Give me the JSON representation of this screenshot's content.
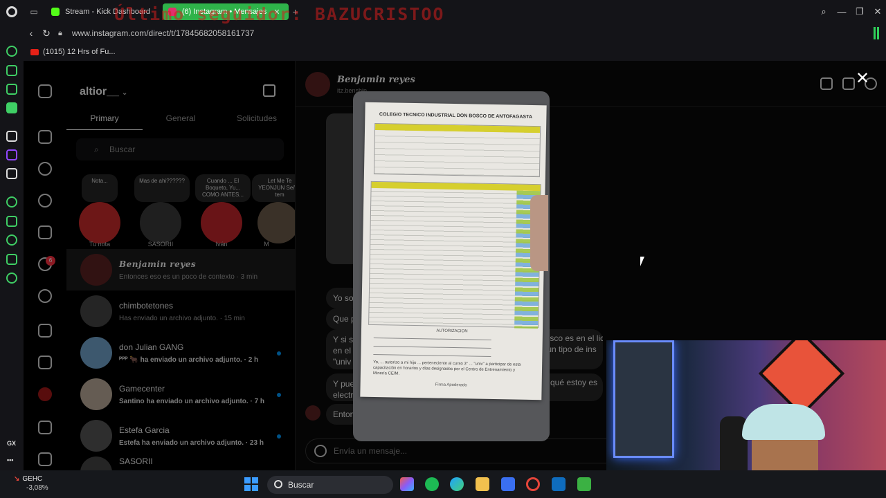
{
  "browser": {
    "tabs": [
      {
        "label": "Stream - Kick Dashboard",
        "active": false,
        "color": "#53fc18"
      },
      {
        "label": "(6) Instagram • Mensajes",
        "active": true,
        "color": "#e1306c"
      }
    ],
    "overlay_text": "Último seguidor: BAZUCRISTOO",
    "url": "www.instagram.com/direct/t/17845682058161737",
    "bookmark": "(1015) 12 Hrs of Fu...",
    "accent": "#2fb34a"
  },
  "instagram": {
    "account": "altior__",
    "tabs": [
      "Primary",
      "General",
      "Solicitudes"
    ],
    "search_placeholder": "Buscar",
    "notifications_badge": "6",
    "notes": [
      {
        "bubble": "Nota...",
        "name": "Tu nota"
      },
      {
        "bubble": "Mas de ahi??????",
        "name": "SASORII"
      },
      {
        "bubble": "Cuando ... El Boqueto, Yu... COMO ANTES...",
        "name": "Iván"
      },
      {
        "bubble": "Let Me Te YEONJUN Señor tem",
        "name": "M"
      }
    ],
    "conversations": [
      {
        "name": "Benjamin reyes",
        "message": "Entonces eso es un poco de contexto · 3 min",
        "selected": true,
        "unread": false
      },
      {
        "name": "chimbotetones",
        "message": "Has enviado un archivo adjunto. · 15 min",
        "selected": false,
        "unread": false
      },
      {
        "name": "don Julian GANG",
        "message": "ᴾᴾᴾ 🐂 ha enviado un archivo adjunto. · 2 h",
        "selected": false,
        "unread": true
      },
      {
        "name": "Gamecenter",
        "message": "Santino ha enviado un archivo adjunto. · 7 h",
        "selected": false,
        "unread": true
      },
      {
        "name": "Estefa Garcia",
        "message": "Estefa ha enviado un archivo adjunto. · 23 h",
        "selected": false,
        "unread": true
      },
      {
        "name": "SASORII",
        "message": "",
        "selected": false,
        "unread": false
      }
    ],
    "chat": {
      "name": "Benjamin reyes",
      "username": "itz.benshin",
      "messages": [
        {
          "text": "Yo so"
        },
        {
          "text": "Que p"
        },
        {
          "text": "Y si s",
          "text2": "en el",
          "text3": "\"univ"
        },
        {
          "text": "Y pue",
          "text2": "electr"
        },
        {
          "text": "Enton"
        }
      ],
      "peek_right_1": "bosco es en el liceo/colegio",
      "peek_right_2": "lgun tipo de ins",
      "peek_right_3": "or qué estoy es",
      "composer_placeholder": "Envía un mensaje..."
    }
  },
  "viewer": {
    "doc_title": "COLEGIO TECNICO INDUSTRIAL DON BOSCO DE ANTOFAGASTA",
    "auth_label": "AUTORIZACION",
    "auth_text": "Yo, ... autorizo a mi hijo ... perteneciente al curso 3° ... \"univ\" a participar de esta capacitación en horarios y días designados por el Centro de Entrenamiento y Minería CEIM.",
    "sign_label": "Firma Apoderado"
  },
  "taskbar": {
    "stock_name": "GEHC",
    "stock_change": "-3,08%",
    "search_placeholder": "Buscar"
  }
}
